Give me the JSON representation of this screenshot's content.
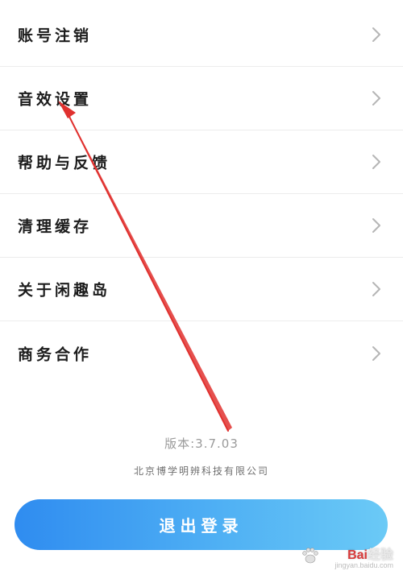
{
  "menu": {
    "items": [
      {
        "label": "账号注销"
      },
      {
        "label": "音效设置"
      },
      {
        "label": "帮助与反馈"
      },
      {
        "label": "清理缓存"
      },
      {
        "label": "关于闲趣岛"
      },
      {
        "label": "商务合作"
      }
    ],
    "chevron_icon": "chevron-right-icon"
  },
  "footer": {
    "version": "版本:3.7.03",
    "company": "北京博学明辨科技有限公司"
  },
  "logout_button": {
    "label": "退出登录"
  },
  "colors": {
    "button_gradient_start": "#2f8cf0",
    "button_gradient_end": "#6bcaf6",
    "annotation_arrow": "#e0312f"
  },
  "watermark": {
    "brand_prefix": "Bai",
    "brand_suffix": "经验",
    "url": "jingyan.baidu.com"
  }
}
